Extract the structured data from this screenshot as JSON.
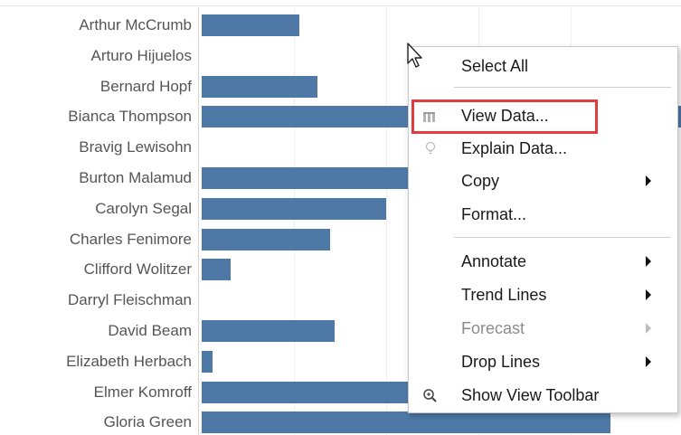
{
  "chart_data": {
    "type": "bar",
    "orientation": "horizontal",
    "categories": [
      "Arthur McCrumb",
      "Arturo Hijuelos",
      "Bernard Hopf",
      "Bianca Thompson",
      "Bravig Lewisohn",
      "Burton Malamud",
      "Carolyn Segal",
      "Charles Fenimore",
      "Clifford Wolitzer",
      "Darryl Fleischman",
      "David Beam",
      "Elizabeth Herbach",
      "Elmer Komroff",
      "Gloria Green"
    ],
    "values": [
      108,
      0,
      128,
      540,
      0,
      260,
      204,
      142,
      32,
      0,
      147,
      12,
      250,
      452
    ],
    "bar_color": "#4e79a7",
    "grid": true
  },
  "context_menu": {
    "items": [
      {
        "label": "Select All",
        "enabled": true,
        "submenu": false,
        "icon": ""
      },
      {
        "label": "View Data...",
        "enabled": true,
        "submenu": false,
        "icon": "view-data-icon",
        "highlighted": true
      },
      {
        "label": "Explain Data...",
        "enabled": false,
        "submenu": false,
        "icon": "lightbulb-icon"
      },
      {
        "label": "Copy",
        "enabled": true,
        "submenu": true,
        "icon": ""
      },
      {
        "label": "Format...",
        "enabled": true,
        "submenu": false,
        "icon": ""
      },
      {
        "label": "Annotate",
        "enabled": true,
        "submenu": true,
        "icon": ""
      },
      {
        "label": "Trend Lines",
        "enabled": true,
        "submenu": true,
        "icon": ""
      },
      {
        "label": "Forecast",
        "enabled": false,
        "submenu": true,
        "icon": ""
      },
      {
        "label": "Drop Lines",
        "enabled": true,
        "submenu": true,
        "icon": ""
      },
      {
        "label": "Show View Toolbar",
        "enabled": true,
        "submenu": false,
        "icon": "zoom-icon"
      }
    ],
    "highlight_color": "#e23c3c"
  }
}
